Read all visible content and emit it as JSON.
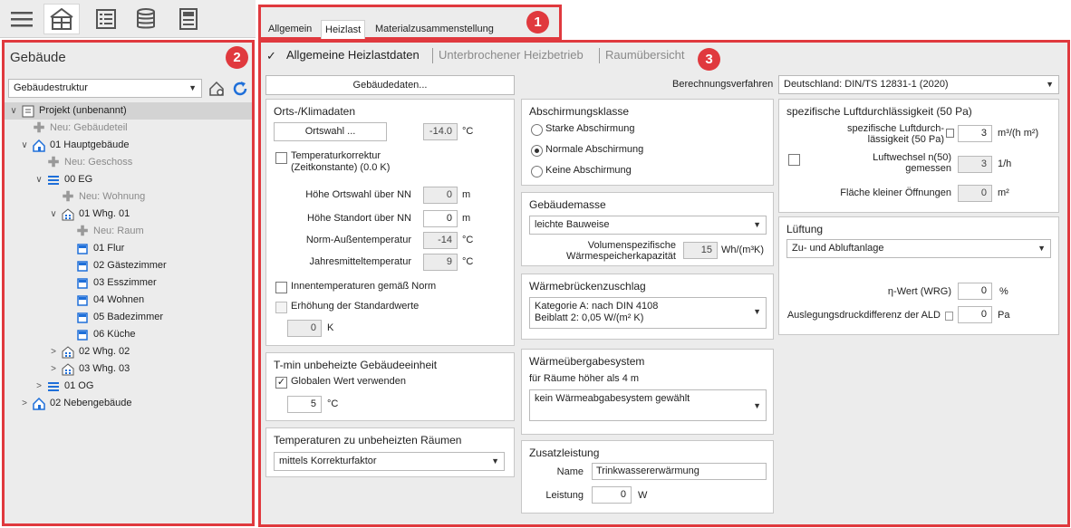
{
  "toolbar": {
    "icons": [
      "menu-icon",
      "building-icon",
      "list-icon",
      "database-icon",
      "calculator-icon"
    ]
  },
  "badges": {
    "one": "1",
    "two": "2",
    "three": "3"
  },
  "left": {
    "title": "Gebäude",
    "structure_select": "Gebäudestruktur",
    "tree": [
      {
        "label": "Projekt (unbenannt)",
        "toggle": "∨"
      },
      {
        "label": "Neu: Gebäudeteil",
        "toggle": ""
      },
      {
        "label": "01 Hauptgebäude",
        "toggle": "∨"
      },
      {
        "label": "Neu: Geschoss",
        "toggle": ""
      },
      {
        "label": "00 EG",
        "toggle": "∨"
      },
      {
        "label": "Neu: Wohnung",
        "toggle": ""
      },
      {
        "label": "01 Whg. 01",
        "toggle": "∨"
      },
      {
        "label": "Neu: Raum",
        "toggle": ""
      },
      {
        "label": "01 Flur",
        "toggle": ""
      },
      {
        "label": "02 Gästezimmer",
        "toggle": ""
      },
      {
        "label": "03 Esszimmer",
        "toggle": ""
      },
      {
        "label": "04 Wohnen",
        "toggle": ""
      },
      {
        "label": "05 Badezimmer",
        "toggle": ""
      },
      {
        "label": "06 Küche",
        "toggle": ""
      },
      {
        "label": "02 Whg. 02",
        "toggle": ">"
      },
      {
        "label": "03 Whg. 03",
        "toggle": ">"
      },
      {
        "label": "01 OG",
        "toggle": ">"
      },
      {
        "label": "02 Nebengebäude",
        "toggle": ">"
      }
    ]
  },
  "tabs": [
    "Allgemein",
    "Heizlast",
    "Materialzusammenstellung"
  ],
  "subnav": {
    "items": [
      "Allgemeine Heizlastdaten",
      "Unterbrochener Heizbetrieb",
      "Raumübersicht"
    ]
  },
  "main": {
    "gebaeudedaten_button": "Gebäudedaten...",
    "berechnungsverfahren": {
      "label": "Berechnungsverfahren",
      "value": "Deutschland: DIN/TS 12831-1 (2020)"
    },
    "orts": {
      "title": "Orts-/Klimadaten",
      "ortswahl_button": "Ortswahl ...",
      "temp": "-14.0",
      "temp_unit": "°C",
      "korrektur_label": "Temperaturkorrektur (Zeitkonstante) (0.0 K)",
      "rows": [
        {
          "label": "Höhe Ortswahl über NN",
          "value": "0",
          "unit": "m"
        },
        {
          "label": "Höhe Standort über NN",
          "value": "0",
          "unit": "m"
        },
        {
          "label": "Norm-Außentemperatur",
          "value": "-14",
          "unit": "°C"
        },
        {
          "label": "Jahresmitteltemperatur",
          "value": "9",
          "unit": "°C"
        }
      ],
      "innentemp_label": "Innentemperaturen gemäß Norm",
      "erhoehung_label": "Erhöhung der Standardwerte",
      "erhoehung_value": "0",
      "erhoehung_unit": "K"
    },
    "tmin": {
      "title": "T-min unbeheizte Gebäudeeinheit",
      "global_label": "Globalen Wert verwenden",
      "check": "✓",
      "value": "5",
      "unit": "°C"
    },
    "temp_unbeheizt": {
      "title": "Temperaturen zu unbeheizten Räumen",
      "select": "mittels Korrekturfaktor"
    },
    "abschirmung": {
      "title": "Abschirmungsklasse",
      "options": [
        "Starke Abschirmung",
        "Normale Abschirmung",
        "Keine Abschirmung"
      ]
    },
    "gebaeudemasse": {
      "title": "Gebäudemasse",
      "select": "leichte Bauweise",
      "kap_label": "Volumenspezifische Wärmespeicherkapazität",
      "kap_value": "15",
      "kap_unit": "Wh/(m³K)"
    },
    "waermebruecken": {
      "title": "Wärmebrückenzuschlag",
      "line1": "Kategorie A: nach DIN 4108",
      "line2": "Beiblatt 2: 0,05 W/(m² K)"
    },
    "waermeuebergabe": {
      "title": "Wärmeübergabesystem",
      "subtitle": "für Räume höher als 4 m",
      "select": "kein Wärmeabgabesystem gewählt"
    },
    "zusatz": {
      "title": "Zusatzleistung",
      "name_label": "Name",
      "name_value": "Trinkwassererwärmung",
      "leistung_label": "Leistung",
      "leistung_value": "0",
      "leistung_unit": "W"
    },
    "luftdicht": {
      "title": "spezifische Luftdurchlässigkeit (50 Pa)",
      "spez_label": "spezifische Luftdurch-lässigkeit (50 Pa)",
      "spez_value": "3",
      "spez_unit": "m³/(h m²)",
      "wechsel_label": "Luftwechsel n(50) gemessen",
      "wechsel_value": "3",
      "wechsel_unit": "1/h",
      "flaeche_label": "Fläche kleiner Öffnungen",
      "flaeche_value": "0",
      "flaeche_unit": "m²"
    },
    "lueftung": {
      "title": "Lüftung",
      "select": "Zu- und Abluftanlage",
      "wrg_label": "η-Wert (WRG)",
      "wrg_value": "0",
      "wrg_unit": "%",
      "ald_label": "Auslegungsdruckdifferenz der ALD",
      "ald_value": "0",
      "ald_unit": "Pa"
    }
  }
}
